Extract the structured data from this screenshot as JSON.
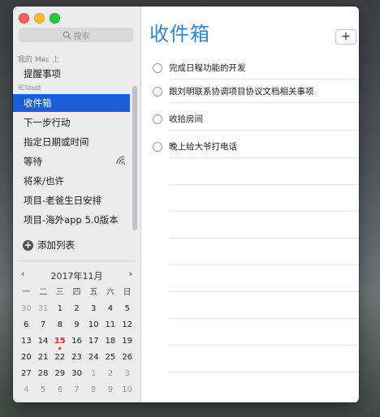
{
  "search": {
    "placeholder": "搜索"
  },
  "sidebar": {
    "mac_group": "我的 Mac 上",
    "mac_items": [
      {
        "label": "提醒事项"
      }
    ],
    "icloud_group": "iCloud",
    "icloud_items": [
      {
        "label": "收件箱",
        "selected": true
      },
      {
        "label": "下一步行动"
      },
      {
        "label": "指定日期或时间"
      },
      {
        "label": "等待",
        "icon": "shared-wifi-icon"
      },
      {
        "label": "将来/也许"
      },
      {
        "label": "项目-老爸生日安排"
      },
      {
        "label": "项目-海外app 5.0版本"
      }
    ],
    "add_list": "添加列表"
  },
  "calendar": {
    "title": "2017年11月",
    "weekdays": [
      "一",
      "二",
      "三",
      "四",
      "五",
      "六",
      "日"
    ],
    "rows": [
      [
        "30",
        "31",
        "1",
        "2",
        "3",
        "4",
        "5"
      ],
      [
        "6",
        "7",
        "8",
        "9",
        "10",
        "11",
        "12"
      ],
      [
        "13",
        "14",
        "15",
        "16",
        "17",
        "18",
        "19"
      ],
      [
        "20",
        "21",
        "22",
        "23",
        "24",
        "25",
        "26"
      ],
      [
        "27",
        "28",
        "29",
        "30",
        "1",
        "2",
        "3"
      ],
      [
        "4",
        "5",
        "6",
        "7",
        "8",
        "9",
        "10"
      ]
    ],
    "today": "15",
    "accent": "#e0282a"
  },
  "main": {
    "title": "收件箱",
    "add_label": "+",
    "tasks": [
      {
        "text": "完成日程功能的开发"
      },
      {
        "text": "跟刘明联系协调项目协议文档相关事项"
      },
      {
        "text": "收拾房间"
      },
      {
        "text": "晚上给大爷打电话"
      }
    ]
  },
  "colors": {
    "selection": "#1b5ed7",
    "title": "#2f86d6"
  }
}
